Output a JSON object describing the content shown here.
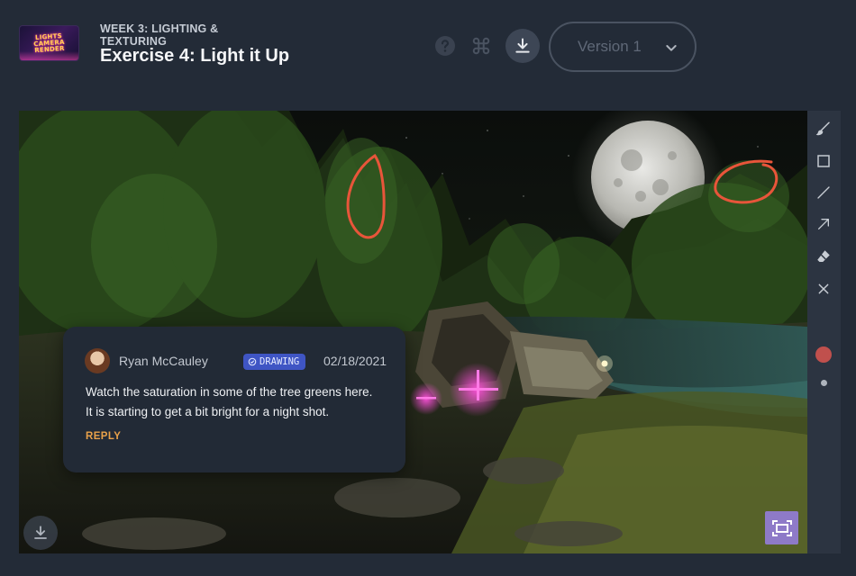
{
  "header": {
    "logo_text": "LIGHTS CAMERA RENDER",
    "kicker": "WEEK 3: LIGHTING & TEXTURING",
    "title": "Exercise 4: Light it Up",
    "icons": [
      "help-icon",
      "command-icon",
      "download-icon"
    ],
    "version_label": "Version 1"
  },
  "toolbar": {
    "tools": [
      "brush-icon",
      "rectangle-icon",
      "line-icon",
      "arrow-icon",
      "eraser-icon",
      "clear-icon"
    ],
    "active_color": "#c0504d"
  },
  "comment": {
    "author": "Ryan McCauley",
    "badge": "DRAWING",
    "date": "02/18/2021",
    "body_line1": "Watch the saturation in some of the tree greens here.",
    "body_line2": "It is starting to get a bit bright for a night shot.",
    "reply_label": "REPLY"
  },
  "colors": {
    "background": "#232b37",
    "accent_badge": "#3f55c4",
    "reply": "#e9a14a",
    "annotation": "#e8553a",
    "fit_button": "#8e7ac8"
  }
}
